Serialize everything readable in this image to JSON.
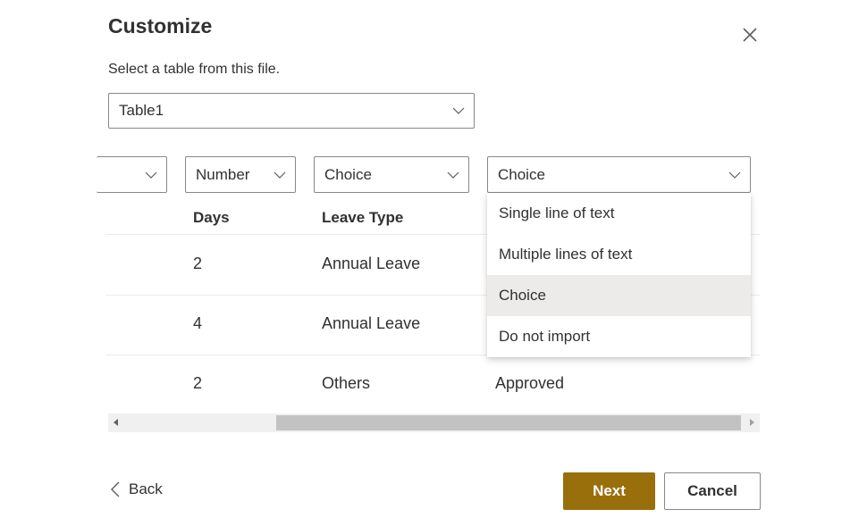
{
  "dialog": {
    "title": "Customize",
    "subtitle": "Select a table from this file.",
    "close_icon": "close-icon"
  },
  "table_select": {
    "value": "Table1"
  },
  "column_types": [
    {
      "value": ""
    },
    {
      "value": "Number"
    },
    {
      "value": "Choice"
    },
    {
      "value": "Choice"
    }
  ],
  "headers": {
    "days": "Days",
    "leave_type": "Leave Type"
  },
  "rows": [
    {
      "days": "2",
      "leave_type": "Annual Leave",
      "status": ""
    },
    {
      "days": "4",
      "leave_type": "Annual Leave",
      "status": ""
    },
    {
      "days": "2",
      "leave_type": "Others",
      "status": "Approved"
    }
  ],
  "dropdown": {
    "options": [
      {
        "label": "Single line of text",
        "selected": false
      },
      {
        "label": "Multiple lines of text",
        "selected": false
      },
      {
        "label": "Choice",
        "selected": true
      },
      {
        "label": "Do not import",
        "selected": false
      }
    ]
  },
  "footer": {
    "back_label": "Back",
    "next_label": "Next",
    "cancel_label": "Cancel"
  },
  "colors": {
    "accent": "#986f0b",
    "selected_option_bg": "#edebe9",
    "text": "#323130"
  }
}
